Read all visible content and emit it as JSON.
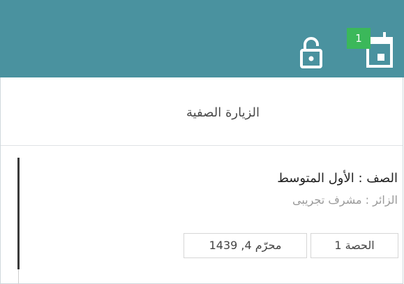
{
  "header": {
    "calendar_badge_count": "1",
    "icons": [
      "lock-open-icon",
      "calendar-icon"
    ],
    "background_color": "#4a929f",
    "badge_color": "#3bb85a"
  },
  "tab": {
    "title": "الزيارة الصفية"
  },
  "visit": {
    "grade_label": "الصف : الأول المتوسط",
    "visitor_label": "الزائر : مشرف تجريبى",
    "session": "الحصة 1",
    "date": "محرّم 4, 1439"
  }
}
